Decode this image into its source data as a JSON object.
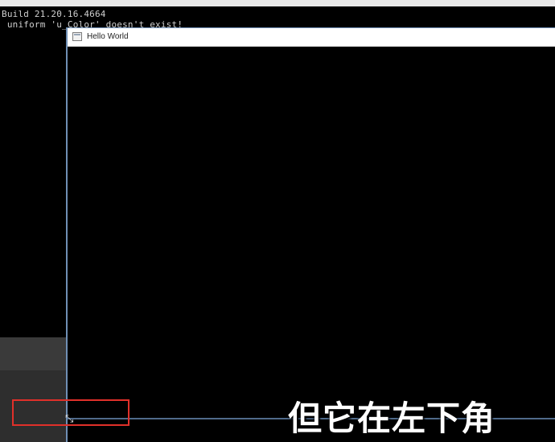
{
  "console": {
    "line1": "Build 21.20.16.4664",
    "line2": " uniform 'u_Color' doesn't exist!"
  },
  "hello_window": {
    "title": "Hello World",
    "icon": "app-window-icon"
  },
  "cursor": {
    "icon": "resize-diagonal-cursor-icon",
    "glyph": "⤡"
  },
  "caption": {
    "text": "但它在左下角"
  },
  "colors": {
    "highlight": "#e0302a",
    "window_border": "#6f8fb5",
    "background": "#000000"
  }
}
